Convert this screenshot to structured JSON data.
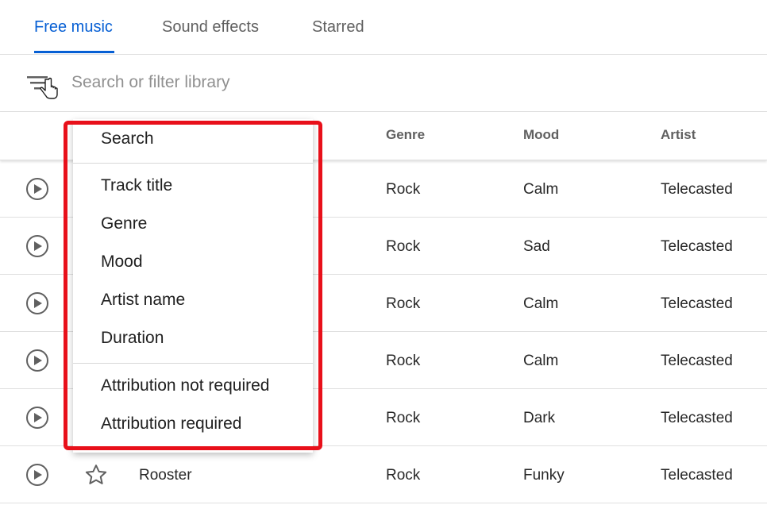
{
  "tabs": [
    {
      "label": "Free music",
      "active": true
    },
    {
      "label": "Sound effects",
      "active": false
    },
    {
      "label": "Starred",
      "active": false
    }
  ],
  "search": {
    "placeholder": "Search or filter library"
  },
  "table": {
    "headers": [
      "Genre",
      "Mood",
      "Artist"
    ],
    "rows": [
      {
        "title": "",
        "genre": "Rock",
        "mood": "Calm",
        "artist": "Telecasted"
      },
      {
        "title": "",
        "genre": "Rock",
        "mood": "Sad",
        "artist": "Telecasted"
      },
      {
        "title": "",
        "genre": "Rock",
        "mood": "Calm",
        "artist": "Telecasted"
      },
      {
        "title": "",
        "genre": "Rock",
        "mood": "Calm",
        "artist": "Telecasted"
      },
      {
        "title": "",
        "genre": "Rock",
        "mood": "Dark",
        "artist": "Telecasted"
      },
      {
        "title": "Rooster",
        "genre": "Rock",
        "mood": "Funky",
        "artist": "Telecasted"
      }
    ]
  },
  "menu": {
    "items": [
      "Search",
      "Track title",
      "Genre",
      "Mood",
      "Artist name",
      "Duration",
      "Attribution not required",
      "Attribution required"
    ]
  },
  "colors": {
    "accent": "#065fd4",
    "highlight": "#e8101a",
    "muted_text": "#606060"
  },
  "icons": {
    "filter": "filter-icon",
    "cursor": "hand-cursor-icon",
    "play": "play-icon",
    "star": "star-outline-icon"
  }
}
